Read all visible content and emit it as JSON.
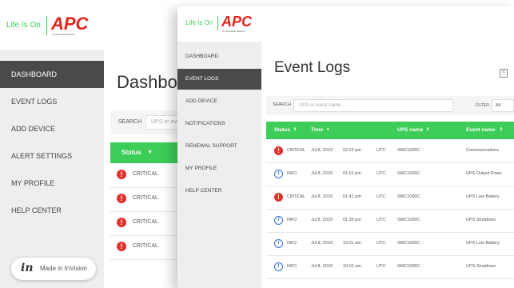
{
  "brand": {
    "tagline": "Life Is On",
    "logo": "APC",
    "sub": "by Schneider Electric",
    "colors": {
      "green": "#3dcd58",
      "red": "#e2231a",
      "sidebar_active": "#4a4a4a"
    }
  },
  "dashboard": {
    "nav": [
      "DASHBOARD",
      "EVENT LOGS",
      "ADD DEVICE",
      "ALERT SETTINGS",
      "MY PROFILE",
      "HELP CENTER"
    ],
    "active": 0,
    "title": "Dashboard",
    "search_label": "SEARCH",
    "search_placeholder": "UPS or event name ...",
    "status_header": "Status",
    "rows": [
      "CRITICAL",
      "CRITICAL",
      "CRITICAL",
      "CRITICAL"
    ]
  },
  "invision": {
    "logo": "in",
    "text": "Made in InVision"
  },
  "eventlogs": {
    "nav": [
      "DASHBOARD",
      "EVENT LOGS",
      "ADD DEVICE",
      "NOTIFICATIONS",
      "RENEWAL SUPPORT",
      "MY PROFILE",
      "HELP CENTER"
    ],
    "active": 1,
    "title": "Event Logs",
    "search_label": "SEARCH",
    "search_placeholder": "UPS or event name ...",
    "filter_label": "FILTER",
    "filter_value": "All",
    "columns": [
      "Status",
      "Time",
      "UPS name",
      "Event name"
    ],
    "rows": [
      {
        "icon": "critical",
        "status": "CRITICAL",
        "date": "Jul 8, 2019",
        "time": "02:22 pm",
        "tz": "UTC",
        "ups": "SMC1000C",
        "event": "Communications"
      },
      {
        "icon": "info",
        "status": "INFO",
        "date": "Jul 8, 2019",
        "time": "01:51 pm",
        "tz": "UTC",
        "ups": "SMC1000C",
        "event": "UPS Output Powe"
      },
      {
        "icon": "critical",
        "status": "CRITICAL",
        "date": "Jul 8, 2019",
        "time": "01:41 pm",
        "tz": "UTC",
        "ups": "SMC1000C",
        "event": "UPS Low Battery"
      },
      {
        "icon": "info",
        "status": "INFO",
        "date": "Jul 8, 2019",
        "time": "01:39 pm",
        "tz": "UTC",
        "ups": "SMC1000C",
        "event": "UPS Shutdown"
      },
      {
        "icon": "info",
        "status": "INFO",
        "date": "Jul 8, 2019",
        "time": "10:01 am",
        "tz": "UTC",
        "ups": "SMC1000C",
        "event": "UPS Low Battery"
      },
      {
        "icon": "info",
        "status": "INFO",
        "date": "Jul 8, 2019",
        "time": "10:01 am",
        "tz": "UTC",
        "ups": "SMC1000C",
        "event": "UPS Shutdown"
      }
    ]
  }
}
